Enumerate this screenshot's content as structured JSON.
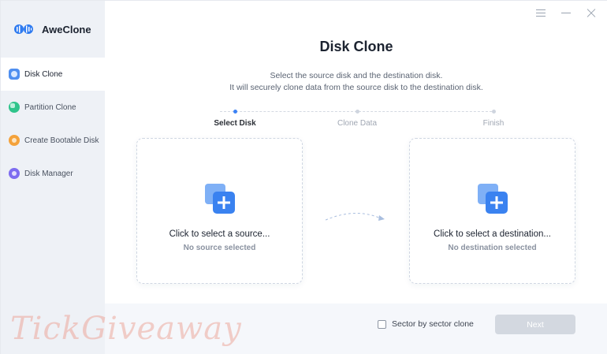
{
  "app": {
    "name": "AweClone"
  },
  "window_controls": {
    "menu": "menu-icon",
    "minimize": "minimize-icon",
    "close": "close-icon"
  },
  "sidebar": {
    "items": [
      {
        "label": "Disk Clone",
        "icon": "disk-clone-icon",
        "active": true
      },
      {
        "label": "Partition Clone",
        "icon": "partition-clone-icon",
        "active": false
      },
      {
        "label": "Create Bootable Disk",
        "icon": "bootable-disk-icon",
        "active": false
      },
      {
        "label": "Disk Manager",
        "icon": "disk-manager-icon",
        "active": false
      }
    ]
  },
  "main": {
    "title": "Disk Clone",
    "description_line1": "Select the source disk and the destination disk.",
    "description_line2": "It will securely clone data from the source disk to the destination disk.",
    "steps": [
      {
        "label": "Select Disk",
        "active": true
      },
      {
        "label": "Clone Data",
        "active": false
      },
      {
        "label": "Finish",
        "active": false
      }
    ],
    "source_card": {
      "title": "Click to select a source...",
      "subtitle": "No source selected"
    },
    "destination_card": {
      "title": "Click to select a destination...",
      "subtitle": "No destination selected"
    }
  },
  "footer": {
    "sector_checkbox_label": "Sector by sector clone",
    "sector_checked": false,
    "next_label": "Next"
  },
  "watermark": "TickGiveaway",
  "colors": {
    "accent": "#3b82f6",
    "sidebar_bg": "#eef1f6",
    "disabled_button": "#d3d8e0"
  }
}
